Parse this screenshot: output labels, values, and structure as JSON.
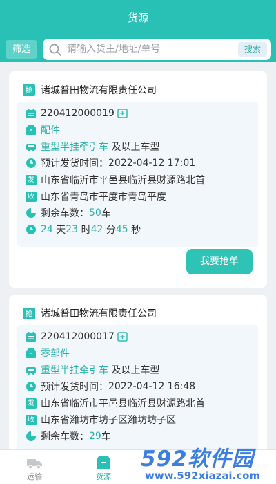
{
  "header": {
    "title": "货源"
  },
  "search": {
    "filter_label": "筛选",
    "placeholder": "请输入货主/地址/单号",
    "submit_label": "搜索"
  },
  "badges": {
    "grab": "抢",
    "depart": "发",
    "receive": "收"
  },
  "cards": [
    {
      "company": "诸城普田物流有限责任公司",
      "order_no": "220412000019",
      "cargo": "配件",
      "vehicle_type": "重型半挂牵引车",
      "vehicle_suffix": "及以上车型",
      "departure_label": "预计发货时间：",
      "departure_time": "2022-04-12 17:01",
      "from": "山东省临沂市平邑县临沂县财源路北首",
      "to": "山东省青岛市平度市青岛平度",
      "remaining_label": "剩余车数：",
      "remaining_count": "50",
      "remaining_unit": "车",
      "countdown": {
        "days": "24",
        "days_unit": "天",
        "hours": "23",
        "hours_unit": "时",
        "minutes": "42",
        "minutes_unit": "分",
        "seconds": "45",
        "seconds_unit": "秒"
      },
      "button": "我要抢单"
    },
    {
      "company": "诸城普田物流有限责任公司",
      "order_no": "220412000017",
      "cargo": "零部件",
      "vehicle_type": "重型半挂牵引车",
      "vehicle_suffix": "及以上车型",
      "departure_label": "预计发货时间：",
      "departure_time": "2022-04-12 16:48",
      "from": "山东省临沂市平邑县临沂县财源路北首",
      "to": "山东省潍坊市坊子区潍坊坊子区",
      "remaining_label": "剩余车数：",
      "remaining_count": "29",
      "remaining_unit": "车"
    }
  ],
  "tabbar": {
    "tabs": [
      {
        "label": "运输",
        "icon": "truck-icon"
      },
      {
        "label": "货源",
        "icon": "cargo-box-icon",
        "active": true
      }
    ]
  },
  "watermark": {
    "brand": "592软件园",
    "url": "www.592xiazai.com"
  },
  "colors": {
    "primary": "#29c1b5",
    "info_bg": "#f2f7fc",
    "page_bg": "#eef1f4",
    "watermark": "#3d7fe0"
  }
}
